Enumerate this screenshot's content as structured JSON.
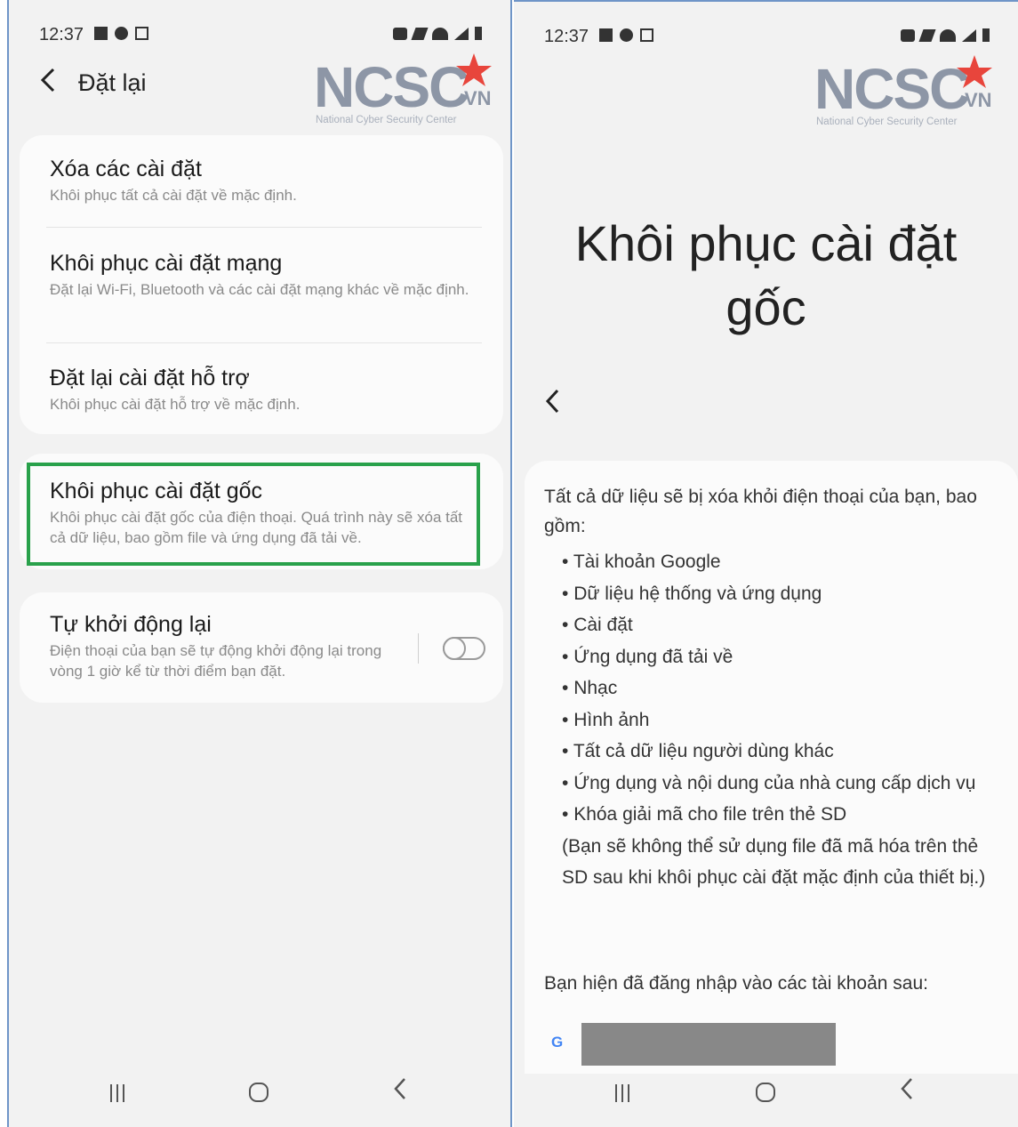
{
  "status": {
    "time": "12:37"
  },
  "logo": {
    "text": "NCSC",
    "vn": "VN",
    "subtitle": "National Cyber Security Center"
  },
  "left_screen": {
    "title": "Đặt lại",
    "groups": [
      [
        {
          "title": "Xóa các cài đặt",
          "desc": "Khôi phục tất cả cài đặt về mặc định."
        },
        {
          "title": "Khôi phục cài đặt mạng",
          "desc": "Đặt lại Wi-Fi, Bluetooth và các cài đặt mạng khác về mặc định."
        },
        {
          "title": "Đặt lại cài đặt hỗ trợ",
          "desc": "Khôi phục cài đặt hỗ trợ về mặc định."
        }
      ],
      [
        {
          "title": "Khôi phục cài đặt gốc",
          "desc": "Khôi phục cài đặt gốc của điện thoại. Quá trình này sẽ xóa tất cả dữ liệu, bao gồm file và ứng dụng đã tải về."
        }
      ],
      [
        {
          "title": "Tự khởi động lại",
          "desc": "Điện thoại của bạn sẽ tự động khởi động lại trong vòng 1 giờ kể từ thời điểm bạn đặt."
        }
      ]
    ],
    "auto_restart_enabled": false
  },
  "right_screen": {
    "title": "Khôi phục cài đặt gốc",
    "intro": "Tất cả dữ liệu sẽ bị xóa khỏi điện thoại của bạn, bao gồm:",
    "items": [
      "Tài khoản Google",
      "Dữ liệu hệ thống và ứng dụng",
      "Cài đặt",
      "Ứng dụng đã tải về",
      "Nhạc",
      "Hình ảnh",
      "Tất cả dữ liệu người dùng khác",
      "Ứng dụng và nội dung của nhà cung cấp dịch vụ",
      "Khóa giải mã cho file trên thẻ SD"
    ],
    "note": "(Bạn sẽ không thể sử dụng file đã mã hóa trên thẻ SD sau khi khôi phục cài đặt mặc định của thiết bị.)",
    "accounts_label": "Bạn hiện đã đăng nhập vào các tài khoản sau:",
    "google_glyph": "G"
  },
  "colors": {
    "highlight": "#29a14b",
    "logo_red": "#e8453c",
    "logo_gray": "#8d96a6"
  },
  "icons": {
    "back": "chevron-left-icon",
    "recent": "recent-apps-icon",
    "home": "home-icon"
  }
}
